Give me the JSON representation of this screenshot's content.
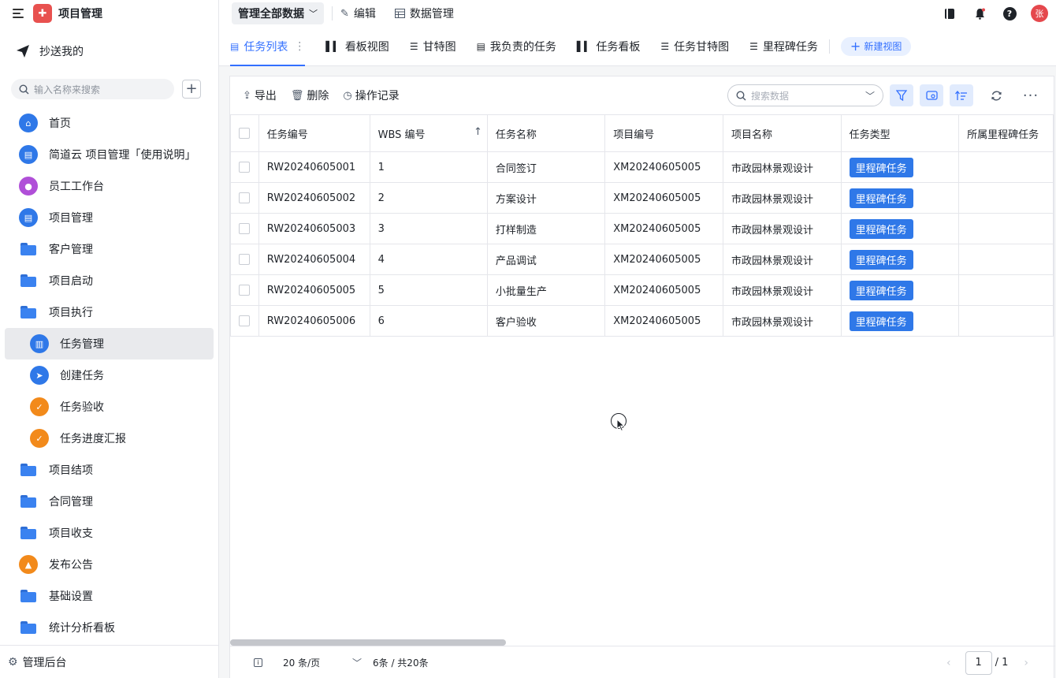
{
  "app": {
    "title": "项目管理",
    "avatar_text": "张"
  },
  "sidebar": {
    "cc_label": "抄送我的",
    "search_placeholder": "输入名称来搜索",
    "add_label": "+",
    "items": [
      {
        "label": "首页",
        "icon": "home-icon",
        "color": "#2f78e8",
        "type": "circle"
      },
      {
        "label": "简道云 项目管理「使用说明」",
        "icon": "doc-icon",
        "color": "#2f78e8",
        "type": "circle"
      },
      {
        "label": "员工工作台",
        "icon": "person-icon",
        "color": "#b04fd8",
        "type": "circle"
      },
      {
        "label": "项目管理",
        "icon": "doc-icon",
        "color": "#2f78e8",
        "type": "circle"
      },
      {
        "label": "客户管理",
        "icon": "folder-icon",
        "type": "folder"
      },
      {
        "label": "项目启动",
        "icon": "folder-icon",
        "type": "folder"
      },
      {
        "label": "项目执行",
        "icon": "folder-open-icon",
        "type": "folder"
      },
      {
        "label": "任务管理",
        "icon": "chart-icon",
        "color": "#2f78e8",
        "type": "circle",
        "sub": true,
        "active": true
      },
      {
        "label": "创建任务",
        "icon": "send-icon",
        "color": "#2f78e8",
        "type": "circle",
        "sub": true
      },
      {
        "label": "任务验收",
        "icon": "shield-icon",
        "color": "#f28a1b",
        "type": "circle",
        "sub": true
      },
      {
        "label": "任务进度汇报",
        "icon": "shield-icon",
        "color": "#f28a1b",
        "type": "circle",
        "sub": true
      },
      {
        "label": "项目结项",
        "icon": "folder-icon",
        "type": "folder"
      },
      {
        "label": "合同管理",
        "icon": "folder-icon",
        "type": "folder"
      },
      {
        "label": "项目收支",
        "icon": "folder-icon",
        "type": "folder"
      },
      {
        "label": "发布公告",
        "icon": "stamp-icon",
        "color": "#f28a1b",
        "type": "circle"
      },
      {
        "label": "基础设置",
        "icon": "folder-icon",
        "type": "folder"
      },
      {
        "label": "统计分析看板",
        "icon": "folder-icon",
        "type": "folder"
      }
    ],
    "admin_label": "管理后台"
  },
  "topbar": {
    "scope_label": "管理全部数据",
    "edit_label": "编辑",
    "data_mgmt_label": "数据管理"
  },
  "tabs": [
    {
      "label": "任务列表",
      "icon": "table-icon",
      "active": true
    },
    {
      "label": "看板视图",
      "icon": "kanban-icon"
    },
    {
      "label": "甘特图",
      "icon": "gantt-icon"
    },
    {
      "label": "我负责的任务",
      "icon": "table-icon"
    },
    {
      "label": "任务看板",
      "icon": "kanban-icon"
    },
    {
      "label": "任务甘特图",
      "icon": "gantt-icon"
    },
    {
      "label": "里程碑任务",
      "icon": "gantt-icon"
    }
  ],
  "new_view_label": "新建视图",
  "toolbar": {
    "export_label": "导出",
    "delete_label": "删除",
    "log_label": "操作记录",
    "search_placeholder": "搜索数据"
  },
  "table": {
    "columns": [
      "任务编号",
      "WBS 编号",
      "任务名称",
      "项目编号",
      "项目名称",
      "任务类型",
      "所属里程碑任务"
    ],
    "rows": [
      [
        "RW20240605001",
        "1",
        "合同签订",
        "XM20240605005",
        "市政园林景观设计",
        "里程碑任务",
        ""
      ],
      [
        "RW20240605002",
        "2",
        "方案设计",
        "XM20240605005",
        "市政园林景观设计",
        "里程碑任务",
        ""
      ],
      [
        "RW20240605003",
        "3",
        "打样制造",
        "XM20240605005",
        "市政园林景观设计",
        "里程碑任务",
        ""
      ],
      [
        "RW20240605004",
        "4",
        "产品调试",
        "XM20240605005",
        "市政园林景观设计",
        "里程碑任务",
        ""
      ],
      [
        "RW20240605005",
        "5",
        "小批量生产",
        "XM20240605005",
        "市政园林景观设计",
        "里程碑任务",
        ""
      ],
      [
        "RW20240605006",
        "6",
        "客户验收",
        "XM20240605005",
        "市政园林景观设计",
        "里程碑任务",
        ""
      ]
    ]
  },
  "pager": {
    "per_page": "20 条/页",
    "total": "6条 / 共20条",
    "page": "1",
    "pages": "/ 1"
  }
}
